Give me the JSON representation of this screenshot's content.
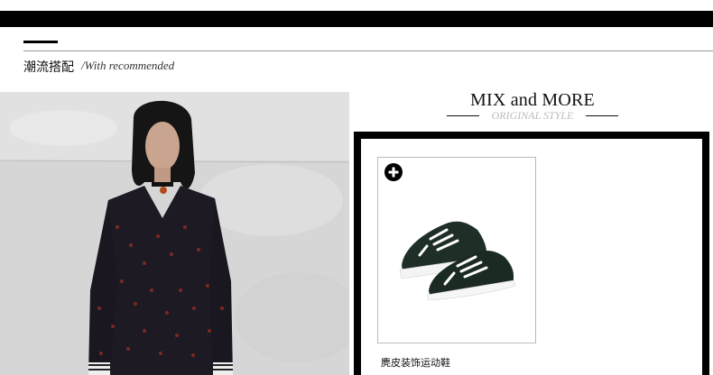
{
  "section": {
    "title": "潮流搭配",
    "subtitle": "/With recommended"
  },
  "mix": {
    "title": "MIX and MORE",
    "subtitle": "ORIGINAL STYLE"
  },
  "product": {
    "name": "麂皮装饰运动鞋",
    "add_icon": "plus-circle-icon"
  },
  "colors": {
    "frame": "#000000",
    "shoe": "#1f2f27",
    "lace": "#ffffff"
  }
}
